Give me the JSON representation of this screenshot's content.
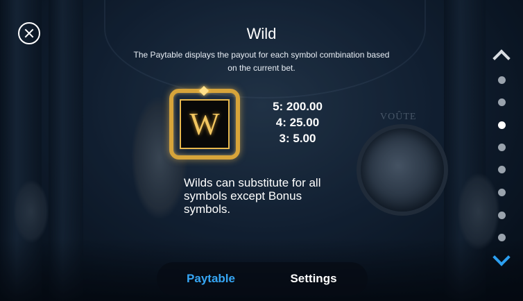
{
  "dialog": {
    "title": "Wild",
    "description": "The Paytable displays the payout for each symbol combination based on the current bet."
  },
  "symbol": {
    "letter": "W",
    "icon": "wild-symbol-icon"
  },
  "payouts": [
    "5: 200.00",
    "4: 25.00",
    "3: 5.00"
  ],
  "wild_text": "Wilds can substitute for all symbols except Bonus symbols.",
  "background": {
    "vault_label": "VOÛTE"
  },
  "pagination": {
    "total": 8,
    "active_index": 2,
    "up_icon": "chevron-up-icon",
    "down_icon": "chevron-down-icon"
  },
  "tabs": [
    {
      "label": "Paytable",
      "active": true
    },
    {
      "label": "Settings",
      "active": false
    }
  ],
  "colors": {
    "accent": "#36a6f4",
    "gold": "#d7a43a"
  }
}
